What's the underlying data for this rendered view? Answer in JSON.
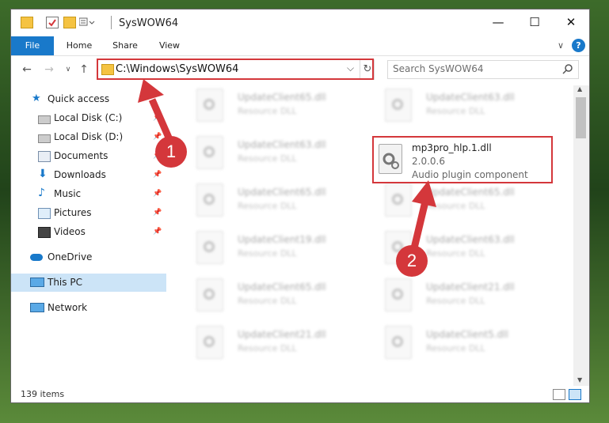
{
  "window": {
    "title": "SysWOW64",
    "controls": {
      "minimize": "—",
      "maximize": "☐",
      "close": "✕"
    }
  },
  "ribbon": {
    "tabs": [
      {
        "label": "File"
      },
      {
        "label": "Home"
      },
      {
        "label": "Share"
      },
      {
        "label": "View"
      }
    ],
    "help": "?",
    "expand": "∨"
  },
  "address_bar": {
    "path": "C:\\Windows\\SysWOW64",
    "refresh": "↻",
    "dropdown": "⌵"
  },
  "search": {
    "placeholder": "Search SysWOW64"
  },
  "sidebar": {
    "items": [
      {
        "label": "Quick access",
        "icon": "star-icon"
      },
      {
        "label": "Local Disk (C:)",
        "icon": "drive-icon"
      },
      {
        "label": "Local Disk (D:)",
        "icon": "drive-icon"
      },
      {
        "label": "Documents",
        "icon": "documents-icon"
      },
      {
        "label": "Downloads",
        "icon": "download-icon"
      },
      {
        "label": "Music",
        "icon": "music-icon"
      },
      {
        "label": "Pictures",
        "icon": "pictures-icon"
      },
      {
        "label": "Videos",
        "icon": "videos-icon"
      },
      {
        "label": "OneDrive",
        "icon": "cloud-icon"
      },
      {
        "label": "This PC",
        "icon": "computer-icon"
      },
      {
        "label": "Network",
        "icon": "network-icon"
      }
    ],
    "pin": "📌"
  },
  "files": [
    {
      "name": "UpdateClient65.dll",
      "desc": "Resource DLL"
    },
    {
      "name": "UpdateClient63.dll",
      "desc": "Resource DLL"
    },
    {
      "name": "UpdateClient63.dll",
      "desc": "Resource DLL"
    },
    {
      "name": "UpdateClient65.dll",
      "desc": "Resource DLL"
    },
    {
      "name": "UpdateClient65.dll",
      "desc": "Resource DLL"
    },
    {
      "name": "UpdateClient19.dll",
      "desc": "Resource DLL"
    },
    {
      "name": "UpdateClient63.dll",
      "desc": "Resource DLL"
    },
    {
      "name": "UpdateClient65.dll",
      "desc": "Resource DLL"
    },
    {
      "name": "UpdateClient21.dll",
      "desc": "Resource DLL"
    },
    {
      "name": "UpdateClient21.dll",
      "desc": "Resource DLL"
    },
    {
      "name": "UpdateClient5.dll",
      "desc": "Resource DLL"
    }
  ],
  "highlighted_file": {
    "name": "mp3pro_hlp.1.dll",
    "version": "2.0.0.6",
    "description": "Audio plugin component"
  },
  "status": {
    "item_count": "139 items"
  },
  "annotations": {
    "step1": "1",
    "step2": "2",
    "color": "#d4373b"
  }
}
